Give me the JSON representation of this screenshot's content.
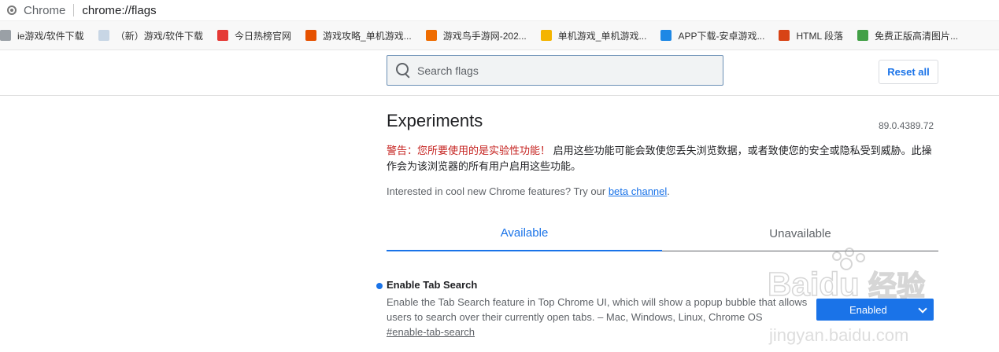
{
  "omnibox": {
    "browser": "Chrome",
    "url": "chrome://flags"
  },
  "bookmarks": [
    {
      "label": "ie游戏/软件下载",
      "color": "#9aa0a6"
    },
    {
      "label": "（新）游戏/软件下载",
      "color": "#c8d6e5"
    },
    {
      "label": "今日热榜官网",
      "color": "#e53935"
    },
    {
      "label": "游戏攻略_单机游戏...",
      "color": "#e65100"
    },
    {
      "label": "游戏鸟手游网-202...",
      "color": "#ef6c00"
    },
    {
      "label": "单机游戏_单机游戏...",
      "color": "#f4b400"
    },
    {
      "label": "APP下载-安卓游戏...",
      "color": "#1e88e5"
    },
    {
      "label": "HTML 段落",
      "color": "#d84315"
    },
    {
      "label": "免费正版高清图片...",
      "color": "#43a047"
    }
  ],
  "search": {
    "placeholder": "Search flags"
  },
  "reset_label": "Reset all",
  "title": "Experiments",
  "version": "89.0.4389.72",
  "warning": {
    "red": "警告：您所要使用的是实验性功能！",
    "rest": "启用这些功能可能会致使您丢失浏览数据，或者致使您的安全或隐私受到威胁。此操作会为该浏览器的所有用户启用这些功能。"
  },
  "interest": {
    "text": "Interested in cool new Chrome features? Try our",
    "link": "beta channel",
    "end": "."
  },
  "tabs": {
    "available": "Available",
    "unavailable": "Unavailable"
  },
  "experiment": {
    "name": "Enable Tab Search",
    "description": "Enable the Tab Search feature in Top Chrome UI, which will show a popup bubble that allows users to search over their currently open tabs. – Mac, Windows, Linux, Chrome OS",
    "link": "#enable-tab-search",
    "state": "Enabled"
  },
  "accent_color": "#1a73e8",
  "watermark": {
    "latin": "Baidu",
    "cn": "经验",
    "sub": "jingyan.baidu.com"
  }
}
